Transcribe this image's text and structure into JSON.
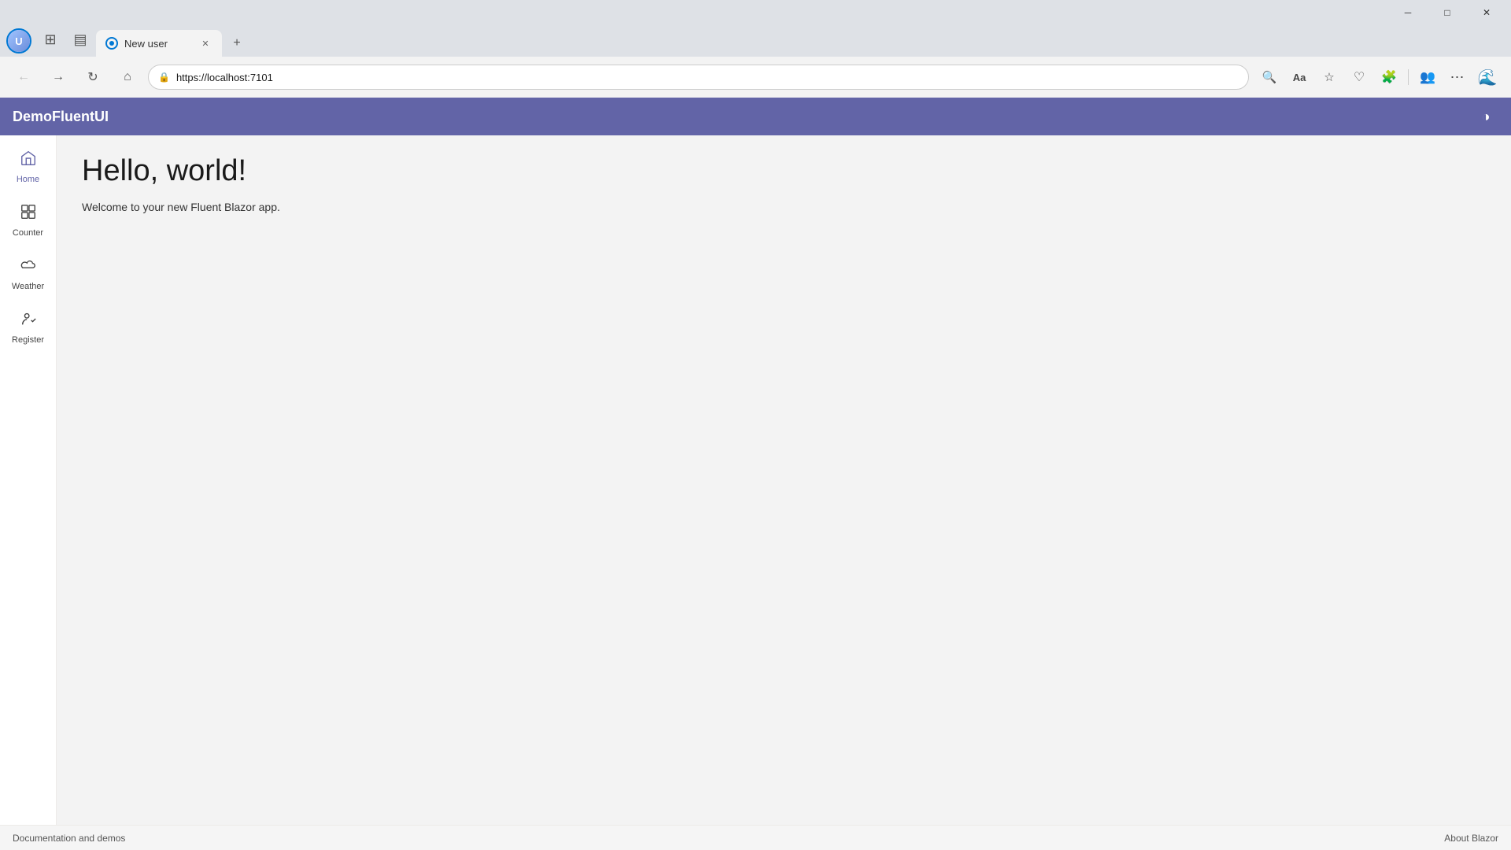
{
  "browser": {
    "title_bar": {
      "minimize_label": "─",
      "maximize_label": "□",
      "close_label": "✕"
    },
    "tab": {
      "title": "New user",
      "close_label": "✕",
      "new_tab_label": "+"
    },
    "address": {
      "url": "https://localhost:7101",
      "lock_icon": "🔒"
    },
    "toolbar": {
      "back_icon": "←",
      "forward_icon": "→",
      "refresh_icon": "↻",
      "home_icon": "⌂",
      "search_icon": "🔍",
      "read_aloud_icon": "Aa",
      "favorites_icon": "☆",
      "collections_icon": "♡",
      "extensions_icon": "🧩",
      "profile_icon": "👤",
      "more_icon": "⋯",
      "edge_icon": "🌐"
    }
  },
  "app": {
    "header": {
      "title": "DemoFluentUI",
      "theme_toggle_icon": "◑"
    },
    "sidebar": {
      "items": [
        {
          "id": "home",
          "label": "Home",
          "icon": "⊞",
          "active": true
        },
        {
          "id": "counter",
          "label": "Counter",
          "icon": "⊞"
        },
        {
          "id": "weather",
          "label": "Weather",
          "icon": "☁"
        },
        {
          "id": "register",
          "label": "Register",
          "icon": "👤"
        }
      ]
    },
    "main": {
      "heading": "Hello, world!",
      "subtext": "Welcome to your new Fluent Blazor app."
    },
    "footer": {
      "left_link": "Documentation and demos",
      "right_link": "About Blazor"
    }
  }
}
